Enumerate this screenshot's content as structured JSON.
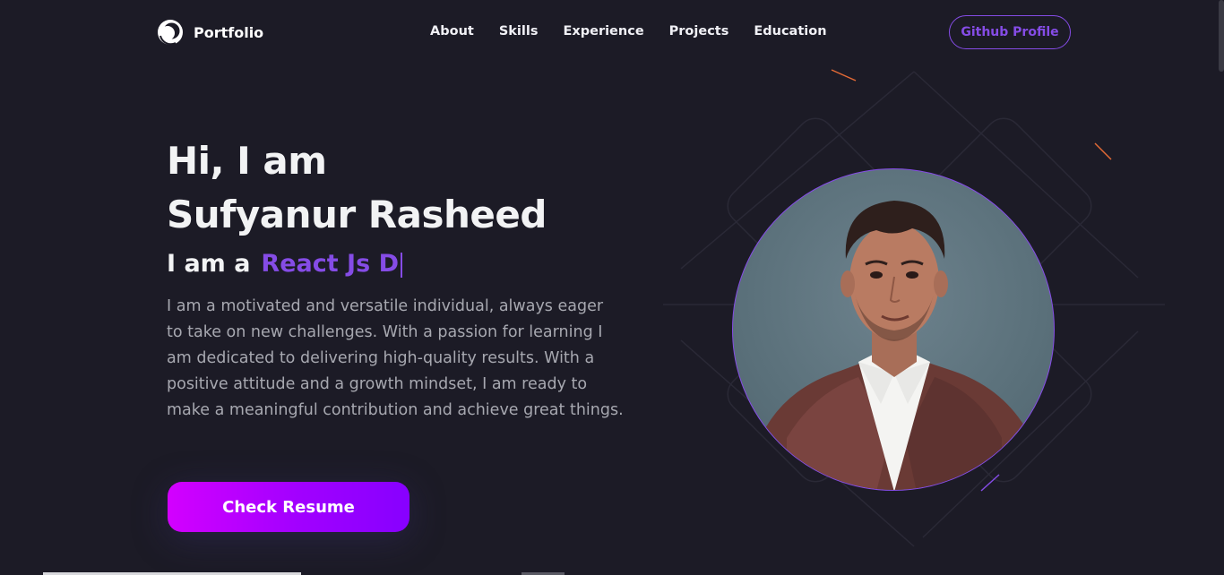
{
  "nav": {
    "logo_text": "Portfolio",
    "links": [
      "About",
      "Skills",
      "Experience",
      "Projects",
      "Education"
    ],
    "github_label": "Github Profile"
  },
  "hero": {
    "greeting": "Hi, I am",
    "name": "Sufyanur Rasheed",
    "role_prefix": "I am a",
    "role_typed": "React Js D",
    "description": "I am a motivated and versatile individual, always eager to take on new challenges. With a passion for learning I am dedicated to delivering high-quality results. With a positive attitude and a growth mindset, I am ready to make a meaningful contribution and achieve great things.",
    "resume_label": "Check Resume"
  },
  "colors": {
    "background": "#1c1b26",
    "accent": "#854ce6",
    "text_primary": "#f2f3f4",
    "text_secondary": "#a7a8b0",
    "button_gradient_start": "#d300ff",
    "button_gradient_end": "#8700ff"
  },
  "icons": {
    "logo": "portfolio-logo-icon"
  },
  "portrait": {
    "subject": "profile-photo"
  }
}
